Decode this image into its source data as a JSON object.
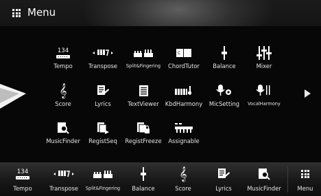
{
  "header": {
    "title": "Menu",
    "icon": "grid-icon"
  },
  "tempo_value": "134",
  "functions": [
    {
      "name": "Tempo",
      "icon": "tempo-icon"
    },
    {
      "name": "Transpose",
      "icon": "transpose-icon"
    },
    {
      "name": "Split&Fingering",
      "icon": "split-fingering-icon"
    },
    {
      "name": "ChordTutor",
      "icon": "chord-tutor-icon"
    },
    {
      "name": "Balance",
      "icon": "balance-icon"
    },
    {
      "name": "Mixer",
      "icon": "mixer-icon"
    },
    {
      "name": "Score",
      "icon": "score-icon"
    },
    {
      "name": "Lyrics",
      "icon": "lyrics-icon"
    },
    {
      "name": "TextViewer",
      "icon": "text-viewer-icon"
    },
    {
      "name": "KbdHarmony",
      "icon": "kbd-harmony-icon"
    },
    {
      "name": "MicSetting",
      "icon": "mic-setting-icon"
    },
    {
      "name": "VocalHarmony",
      "icon": "vocal-harmony-icon"
    },
    {
      "name": "MusicFinder",
      "icon": "music-finder-icon"
    },
    {
      "name": "RegistSeq",
      "icon": "regist-seq-icon"
    },
    {
      "name": "RegistFreeze",
      "icon": "regist-freeze-icon"
    },
    {
      "name": "Assignable",
      "icon": "assignable-icon"
    }
  ],
  "shortcuts": [
    {
      "name": "Tempo",
      "icon": "tempo-icon"
    },
    {
      "name": "Transpose",
      "icon": "transpose-icon"
    },
    {
      "name": "Split&Fingering",
      "icon": "split-fingering-icon"
    },
    {
      "name": "Balance",
      "icon": "balance-icon"
    },
    {
      "name": "Score",
      "icon": "score-icon"
    },
    {
      "name": "Lyrics",
      "icon": "lyrics-icon"
    },
    {
      "name": "MusicFinder",
      "icon": "music-finder-icon"
    }
  ],
  "menu_button": {
    "label": "Menu",
    "icon": "grid-icon"
  },
  "next_page_icon": "next-page-arrow-icon",
  "colors": {
    "background": "#0b0b0b",
    "text": "#ffffff",
    "panel": "#070707"
  }
}
